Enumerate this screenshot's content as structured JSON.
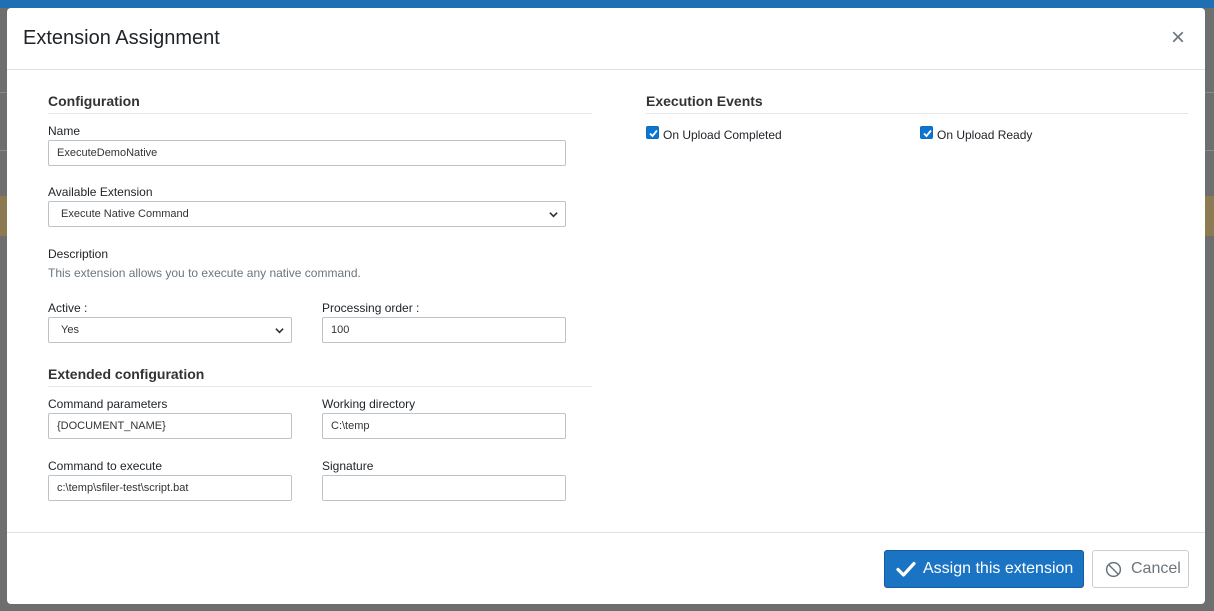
{
  "modal": {
    "title": "Extension Assignment",
    "close_symbol": "×"
  },
  "configuration": {
    "section_title": "Configuration",
    "name": {
      "label": "Name",
      "value": "ExecuteDemoNative"
    },
    "available_extension": {
      "label": "Available Extension",
      "selected": "Execute Native Command"
    },
    "description": {
      "label": "Description",
      "text": "This extension allows you to execute any native command."
    },
    "active": {
      "label": "Active :",
      "selected": "Yes"
    },
    "processing_order": {
      "label": "Processing order :",
      "value": "100"
    }
  },
  "extended_configuration": {
    "section_title": "Extended configuration",
    "command_parameters": {
      "label": "Command parameters",
      "value": "{DOCUMENT_NAME}"
    },
    "working_directory": {
      "label": "Working directory",
      "value": "C:\\temp"
    },
    "command_to_execute": {
      "label": "Command to execute",
      "value": "c:\\temp\\sfiler-test\\script.bat"
    },
    "signature": {
      "label": "Signature",
      "value": ""
    }
  },
  "execution_events": {
    "section_title": "Execution Events",
    "events": [
      {
        "label": "On Upload Completed",
        "checked": true
      },
      {
        "label": "On Upload Ready",
        "checked": true
      }
    ]
  },
  "footer": {
    "assign_label": "Assign this extension",
    "cancel_label": "Cancel"
  },
  "icons": {
    "close": "close-icon",
    "check": "checkmark-icon",
    "cancel": "ban-icon",
    "dropdown": "chevron-down-icon"
  },
  "colors": {
    "primary": "#1b74c3",
    "header_bar": "#1f6fb5",
    "checkbox": "#0b76d1"
  }
}
